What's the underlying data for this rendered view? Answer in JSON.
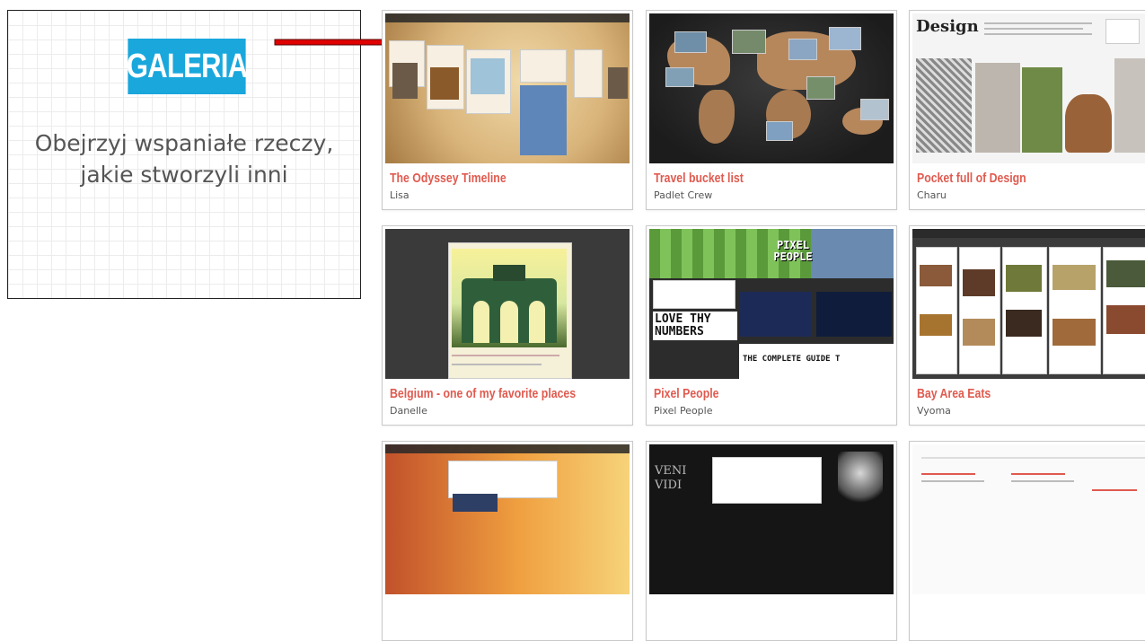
{
  "promo": {
    "badge": "GALERIA",
    "line1": "Obejrzyj wspaniałe rzeczy,",
    "line2": "jakie stworzyli inni",
    "badge_color": "#19a7dc"
  },
  "arrow_color": "#e00000",
  "title_color": "#e05a4f",
  "gallery": [
    {
      "title": "The Odyssey Timeline",
      "author": "Lisa"
    },
    {
      "title": "Travel bucket list",
      "author": "Padlet Crew"
    },
    {
      "title": "Pocket full of Design",
      "author": "Charu"
    },
    {
      "title": "Belgium - one of my favorite places",
      "author": "Danelle"
    },
    {
      "title": "Pixel People",
      "author": "Pixel People"
    },
    {
      "title": "Bay Area Eats",
      "author": "Vyoma"
    },
    {
      "title": "",
      "author": ""
    },
    {
      "title": "",
      "author": ""
    },
    {
      "title": "",
      "author": ""
    }
  ],
  "thumb_text": {
    "pocket_header": "Design",
    "pixel_logo": "PIXEL PEOPLE",
    "pixel_love": "LOVE THY NUMBERS",
    "pixel_guide": "THE COMPLETE GUIDE T",
    "veni": "VENI VIDI"
  }
}
